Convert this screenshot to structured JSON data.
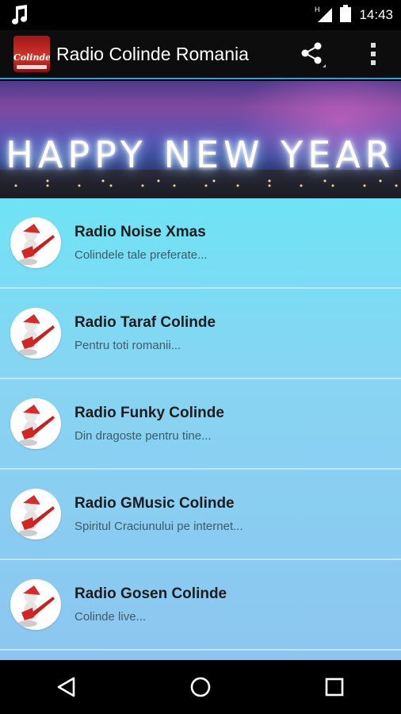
{
  "status_bar": {
    "time": "14:43",
    "left_icon": "music-note-icon",
    "icons": [
      "signal-icon",
      "battery-icon"
    ]
  },
  "app_bar": {
    "title": "Radio Colinde Romania",
    "logo_text": "Colinde",
    "share_icon": "share-icon",
    "overflow_icon": "overflow-menu-icon"
  },
  "banner": {
    "text": "HAPPY NEW YEAR"
  },
  "stations": [
    {
      "title": "Radio Noise Xmas",
      "subtitle": "Colindele tale preferate..."
    },
    {
      "title": "Radio Taraf Colinde",
      "subtitle": "Pentru toti romanii..."
    },
    {
      "title": "Radio Funky Colinde",
      "subtitle": "Din dragoste pentru tine..."
    },
    {
      "title": "Radio GMusic Colinde",
      "subtitle": "Spiritul Craciunului pe internet..."
    },
    {
      "title": "Radio Gosen Colinde",
      "subtitle": "Colinde live..."
    }
  ],
  "nav": {
    "back_icon": "back-icon",
    "home_icon": "home-icon",
    "recents_icon": "recents-icon"
  },
  "colors": {
    "accent": "#1fa8e0",
    "list_bg": "#7fdaf4",
    "app_bar": "#0d0d0d"
  }
}
